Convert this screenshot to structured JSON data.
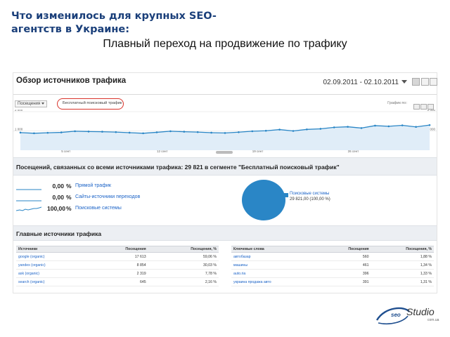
{
  "slide": {
    "title": "Что изменилось для крупных SEO-агентств в Украине:",
    "subtitle": "Плавный переход на продвижение по трафику"
  },
  "report": {
    "title": "Обзор источников трафика",
    "date_range": "02.09.2011 - 02.10.2011",
    "segment_dropdown": "Посещения",
    "segment_label": "Бесплатный поисковый трафик",
    "graph_by_label": "График по:",
    "highlight_color": "#d9342b",
    "accent_color": "#2a86c6"
  },
  "chart_data": {
    "type": "area",
    "yticks": [
      "2 000",
      "1 000"
    ],
    "ytick_values": [
      2000,
      1000
    ],
    "xtick_labels": [
      "5 сент",
      "12 сент",
      "19 сент",
      "26 сент"
    ],
    "xtick_indices": [
      3,
      10,
      17,
      24
    ],
    "ylim": [
      0,
      2000
    ],
    "values": [
      915,
      880,
      905,
      925,
      985,
      970,
      960,
      940,
      910,
      880,
      930,
      985,
      960,
      940,
      910,
      895,
      935,
      985,
      1010,
      1070,
      1000,
      1080,
      1110,
      1185,
      1215,
      1150,
      1275,
      1240,
      1290,
      1210,
      1305
    ],
    "line_color": "#2a86c6",
    "fill_color": "#e0edf8"
  },
  "summary": {
    "text": "Посещений, связанных со всеми источниками трафика: 29 821 в сегменте \"Бесплатный поисковый трафик\""
  },
  "sources": [
    {
      "pct": "0,00",
      "unit": "%",
      "label": "Прямой трафик"
    },
    {
      "pct": "0,00",
      "unit": "%",
      "label": "Сайты-источники переходов"
    },
    {
      "pct": "100,00",
      "unit": "%",
      "label": "Поисковые системы"
    }
  ],
  "pie": {
    "label": "Поисковые системы",
    "value_text": "29 821,00 (100,00 %)",
    "share": 1.0
  },
  "top_sources": {
    "title": "Главные источники трафика",
    "sources_table": {
      "headers": [
        "Источники",
        "Посещения",
        "Посещения, %"
      ],
      "rows": [
        [
          "google (organic)",
          "17 613",
          "59,06 %"
        ],
        [
          "yandex (organic)",
          "8 854",
          "30,03 %"
        ],
        [
          "ask (organic)",
          "2 319",
          "7,78 %"
        ],
        [
          "search (organic)",
          "645",
          "2,16 %"
        ]
      ]
    },
    "keywords_table": {
      "headers": [
        "Ключевые слова",
        "Посещения",
        "Посещения, %"
      ],
      "rows": [
        [
          "автобазар",
          "560",
          "1,88 %"
        ],
        [
          "машины",
          "461",
          "1,34 %"
        ],
        [
          "auto.ria",
          "396",
          "1,33 %"
        ],
        [
          "украина продажа авто",
          "391",
          "1,31 %"
        ]
      ]
    }
  },
  "logo": {
    "name": "Studio",
    "prefix": "seo",
    "sub": "com.ua"
  }
}
